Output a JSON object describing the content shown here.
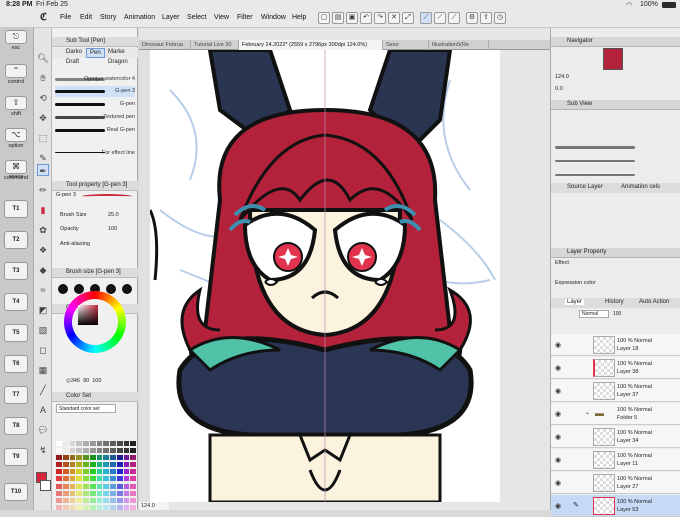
{
  "status": {
    "time": "8:28 PM",
    "date": "Fri Feb 25",
    "battery": "100%"
  },
  "menu": [
    "File",
    "Edit",
    "Story",
    "Animation",
    "Layer",
    "Select",
    "View",
    "Filter",
    "Window",
    "Help"
  ],
  "edge_keys": [
    {
      "label": "esc",
      "icon": "esc-key"
    },
    {
      "label": "control",
      "icon": "control-key"
    },
    {
      "label": "shift",
      "icon": "shift-key"
    },
    {
      "label": "option",
      "icon": "option-key"
    },
    {
      "label": "command",
      "icon": "command-key"
    },
    {
      "label": "space",
      "icon": "space-key"
    }
  ],
  "fkeys": [
    "T1",
    "T2",
    "T3",
    "T4",
    "T5",
    "T6",
    "T7",
    "T8",
    "T9",
    "T10"
  ],
  "subtool": {
    "title": "Sub Tool [Pen]",
    "tabs": [
      "Darko",
      "Pen",
      "Marke",
      "Draft",
      "Dragon"
    ],
    "brushes": [
      "Opaque watercolor 4",
      "G-pen 3",
      "G-pen",
      "Textured pen",
      "Real G-pen",
      "For effect line"
    ],
    "property_title": "Tool property [G-pen 3]",
    "brush_name": "G-pen 3",
    "brush_size_label": "Brush Size",
    "brush_size_value": "25.0",
    "opacity_label": "Opacity",
    "opacity_value": "100",
    "antialias_label": "Anti-aliasing",
    "brush_size_panel": "Brush size [G-pen 3]",
    "color_wheel_title": "Color Wheel",
    "color_values": {
      "h": "346",
      "s": "90",
      "v": "100"
    },
    "color_set_title": "Color Set",
    "color_set_select": "Standard color set"
  },
  "doc_tabs": [
    "Dinosaur Februa",
    "Tutorial Live 20",
    "February 24.2022* (2559 x 2796px 300dpi 124.0%)",
    "Sexo",
    "Illustration5(Re"
  ],
  "zoom": "124.0",
  "rightpanel": {
    "navigator_title": "Navigator",
    "nav_zoom": "124.0",
    "nav_rot": "0.0",
    "subview_title": "Sub View",
    "tabs2": [
      "Source Layer",
      "Animation cels"
    ],
    "layer_property_title": "Layer Property",
    "effect_label": "Effect",
    "expression_label": "Expression color",
    "layer_tabs": [
      "Layer",
      "History",
      "Auto Action"
    ],
    "blend_mode": "Normal",
    "opacity_pct": "100",
    "layers": [
      {
        "pct": "100 %",
        "mode": "Normal",
        "name": "Layer 18"
      },
      {
        "pct": "100 %",
        "mode": "Normal",
        "name": "Layer 38"
      },
      {
        "pct": "100 %",
        "mode": "Normal",
        "name": "Layer 37"
      },
      {
        "pct": "100 %",
        "mode": "Normal",
        "name": "Folder 5"
      },
      {
        "pct": "100 %",
        "mode": "Normal",
        "name": "Layer 34"
      },
      {
        "pct": "100 %",
        "mode": "Normal",
        "name": "Layer 11"
      },
      {
        "pct": "100 %",
        "mode": "Normal",
        "name": "Layer 27"
      },
      {
        "pct": "100 %",
        "mode": "Normal",
        "name": "Layer 53"
      }
    ]
  },
  "colors": {
    "accent": "#3b78d8",
    "hair": "#b3213a",
    "horn": "#2a3552",
    "teal": "#4fc2a8",
    "skin": "#fbf3dd",
    "top": "#2a3654"
  }
}
